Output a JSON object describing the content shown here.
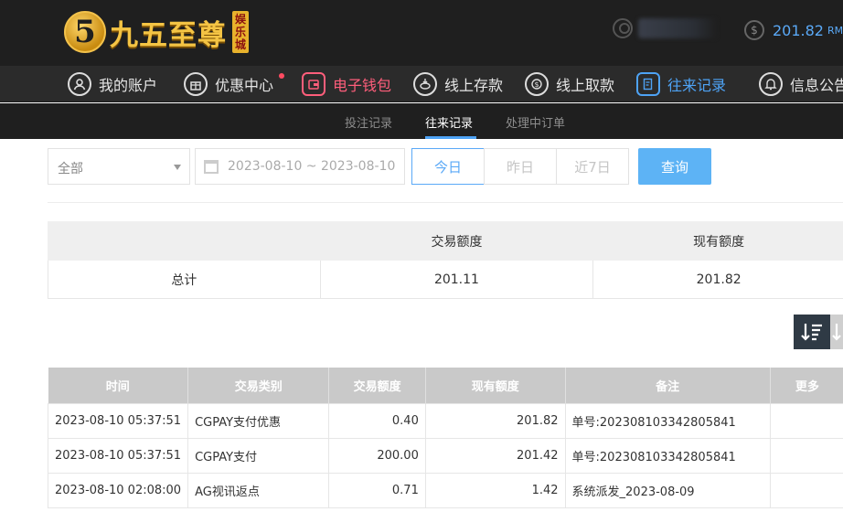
{
  "header": {
    "logo_mark": "5",
    "logo_text": "九五至尊",
    "logo_badge": "娱乐城",
    "balance": "201.82",
    "currency": "RMB"
  },
  "nav": {
    "items": [
      {
        "label": "我的账户",
        "icon": "user-icon"
      },
      {
        "label": "优惠中心",
        "icon": "gift-icon"
      },
      {
        "label": "电子钱包",
        "icon": "wallet-icon"
      },
      {
        "label": "线上存款",
        "icon": "deposit-icon"
      },
      {
        "label": "线上取款",
        "icon": "withdraw-icon"
      },
      {
        "label": "往来记录",
        "icon": "records-icon"
      },
      {
        "label": "信息公告",
        "icon": "bell-icon"
      }
    ]
  },
  "subnav": {
    "items": [
      "投注记录",
      "往来记录",
      "处理中订单"
    ]
  },
  "filters": {
    "type_selected": "全部",
    "date_range": "2023-08-10 ~ 2023-08-10",
    "quick": [
      "今日",
      "昨日",
      "近7日"
    ],
    "search_label": "查询"
  },
  "summary": {
    "headers": [
      "",
      "交易额度",
      "现有额度"
    ],
    "row": [
      "总计",
      "201.11",
      "201.82"
    ]
  },
  "table": {
    "headers": [
      "时间",
      "交易类别",
      "交易额度",
      "现有额度",
      "备注",
      "更多"
    ],
    "rows": [
      [
        "2023-08-10 05:37:51",
        "CGPAY支付优惠",
        "0.40",
        "201.82",
        "单号:202308103342805841",
        ""
      ],
      [
        "2023-08-10 05:37:51",
        "CGPAY支付",
        "200.00",
        "201.42",
        "单号:202308103342805841",
        ""
      ],
      [
        "2023-08-10 02:08:00",
        "AG视讯返点",
        "0.71",
        "1.42",
        "系统派发_2023-08-09",
        ""
      ]
    ]
  },
  "colors": {
    "accent": "#5aa9f7",
    "wallet": "#ff5e7b",
    "header_bg": "#1f1f1f",
    "nav_bg": "#2b2b2b"
  }
}
